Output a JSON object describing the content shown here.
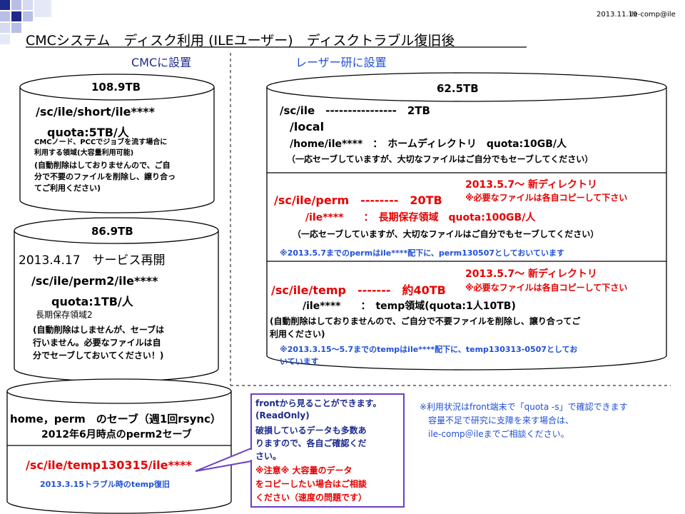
{
  "header": {
    "date": "2013.11.19",
    "author": "ile-comp@ile",
    "title": "CMCシステム　ディスク利用 (ILEユーザー)　ディスクトラブル復旧後"
  },
  "sections": {
    "cmc": "CMCに設置",
    "laser": "レーザー研に設置"
  },
  "disk1": {
    "capacity": "108.9TB",
    "path": "/sc/ile/short/ile****",
    "quota": "quota:5TB/人",
    "note": [
      "CMCノード、PCCでジョブを流す場合に",
      "利用する領域(大容量利用可能)",
      "(自動削除はしておりませんので、ご自",
      "分で不要のファイルを削除し、譲り合っ",
      "てご利用ください)"
    ]
  },
  "disk2": {
    "capacity": "86.9TB",
    "service": "2013.4.17　サービス再開",
    "path": "/sc/ile/perm2/ile****",
    "quota": "quota:1TB/人",
    "note": [
      "長期保存領域2",
      "(自動削除はしませんが、セーブは",
      "行いません。必要なファイルは自",
      "分でセーブしておいてください！)"
    ]
  },
  "disk3": {
    "title": "home，perm　のセーブ（週1回rsync）",
    "subtitle": "2012年6月時点のperm2セーブ",
    "path": "/sc/ile/temp130315/ile****",
    "note": "2013.3.15トラブル時のtemp復旧"
  },
  "disk4": {
    "capacity": "62.5TB",
    "sc_ile": "/sc/ile　----------------　2TB",
    "local": "/local",
    "home": "/home/ile****　：　ホームディレクトリ　quota:10GB/人",
    "home_note": "（一応セーブしていますが、大切なファイルはご自分でもセーブしてください）",
    "perm_new": "2013.5.7～ 新ディレクトリ",
    "perm_copy": "※必要なファイルは各自コピーして下さい",
    "perm": "/sc/ile/perm　--------　20TB",
    "perm_user": "/ile****　　：　長期保存領域　quota:100GB/人",
    "perm_note": "（一応セーブしていますが、大切なファイルはご自分でもセーブしてください）",
    "perm_notice": "※2013.5.7までのpermはile****配下に、perm130507としておいています",
    "temp_new": "2013.5.7～ 新ディレクトリ",
    "temp_copy": "※必要なファイルは各自コピーして下さい",
    "temp": "/sc/ile/temp　-------　約40TB",
    "temp_user": "/ile****　　：　temp領域(quota:1人10TB)",
    "temp_note": [
      "(自動削除はしておりませんので、ご自分で不要ファイルを削除し、譲り合ってご",
      "利用ください)"
    ],
    "temp_notice": [
      "※2013.3.15～5.7までのtempはile****配下に、temp130313-0507としてお",
      "いています"
    ]
  },
  "callout": {
    "lines": [
      "frontから見ることができます。",
      "(ReadOnly)",
      "破損しているデータも多数あ",
      "りますので、各自ご確認くだ",
      "さい。"
    ],
    "warn": [
      "※注意※ 大容量のデータ",
      "をコピーしたい場合はご相談",
      "ください（速度の問題です）"
    ]
  },
  "footnote": [
    "※利用状況はfront端末で「quota -s」で確認できます",
    "容量不足で研究に支障を来す場合は、",
    "ile-comp＠ileまでご相談ください。"
  ],
  "colors": {
    "accent_navy": "#1c2a8c",
    "red": "#e60000",
    "blue": "#1f4fd6",
    "callout_border": "#6a3fc8"
  }
}
